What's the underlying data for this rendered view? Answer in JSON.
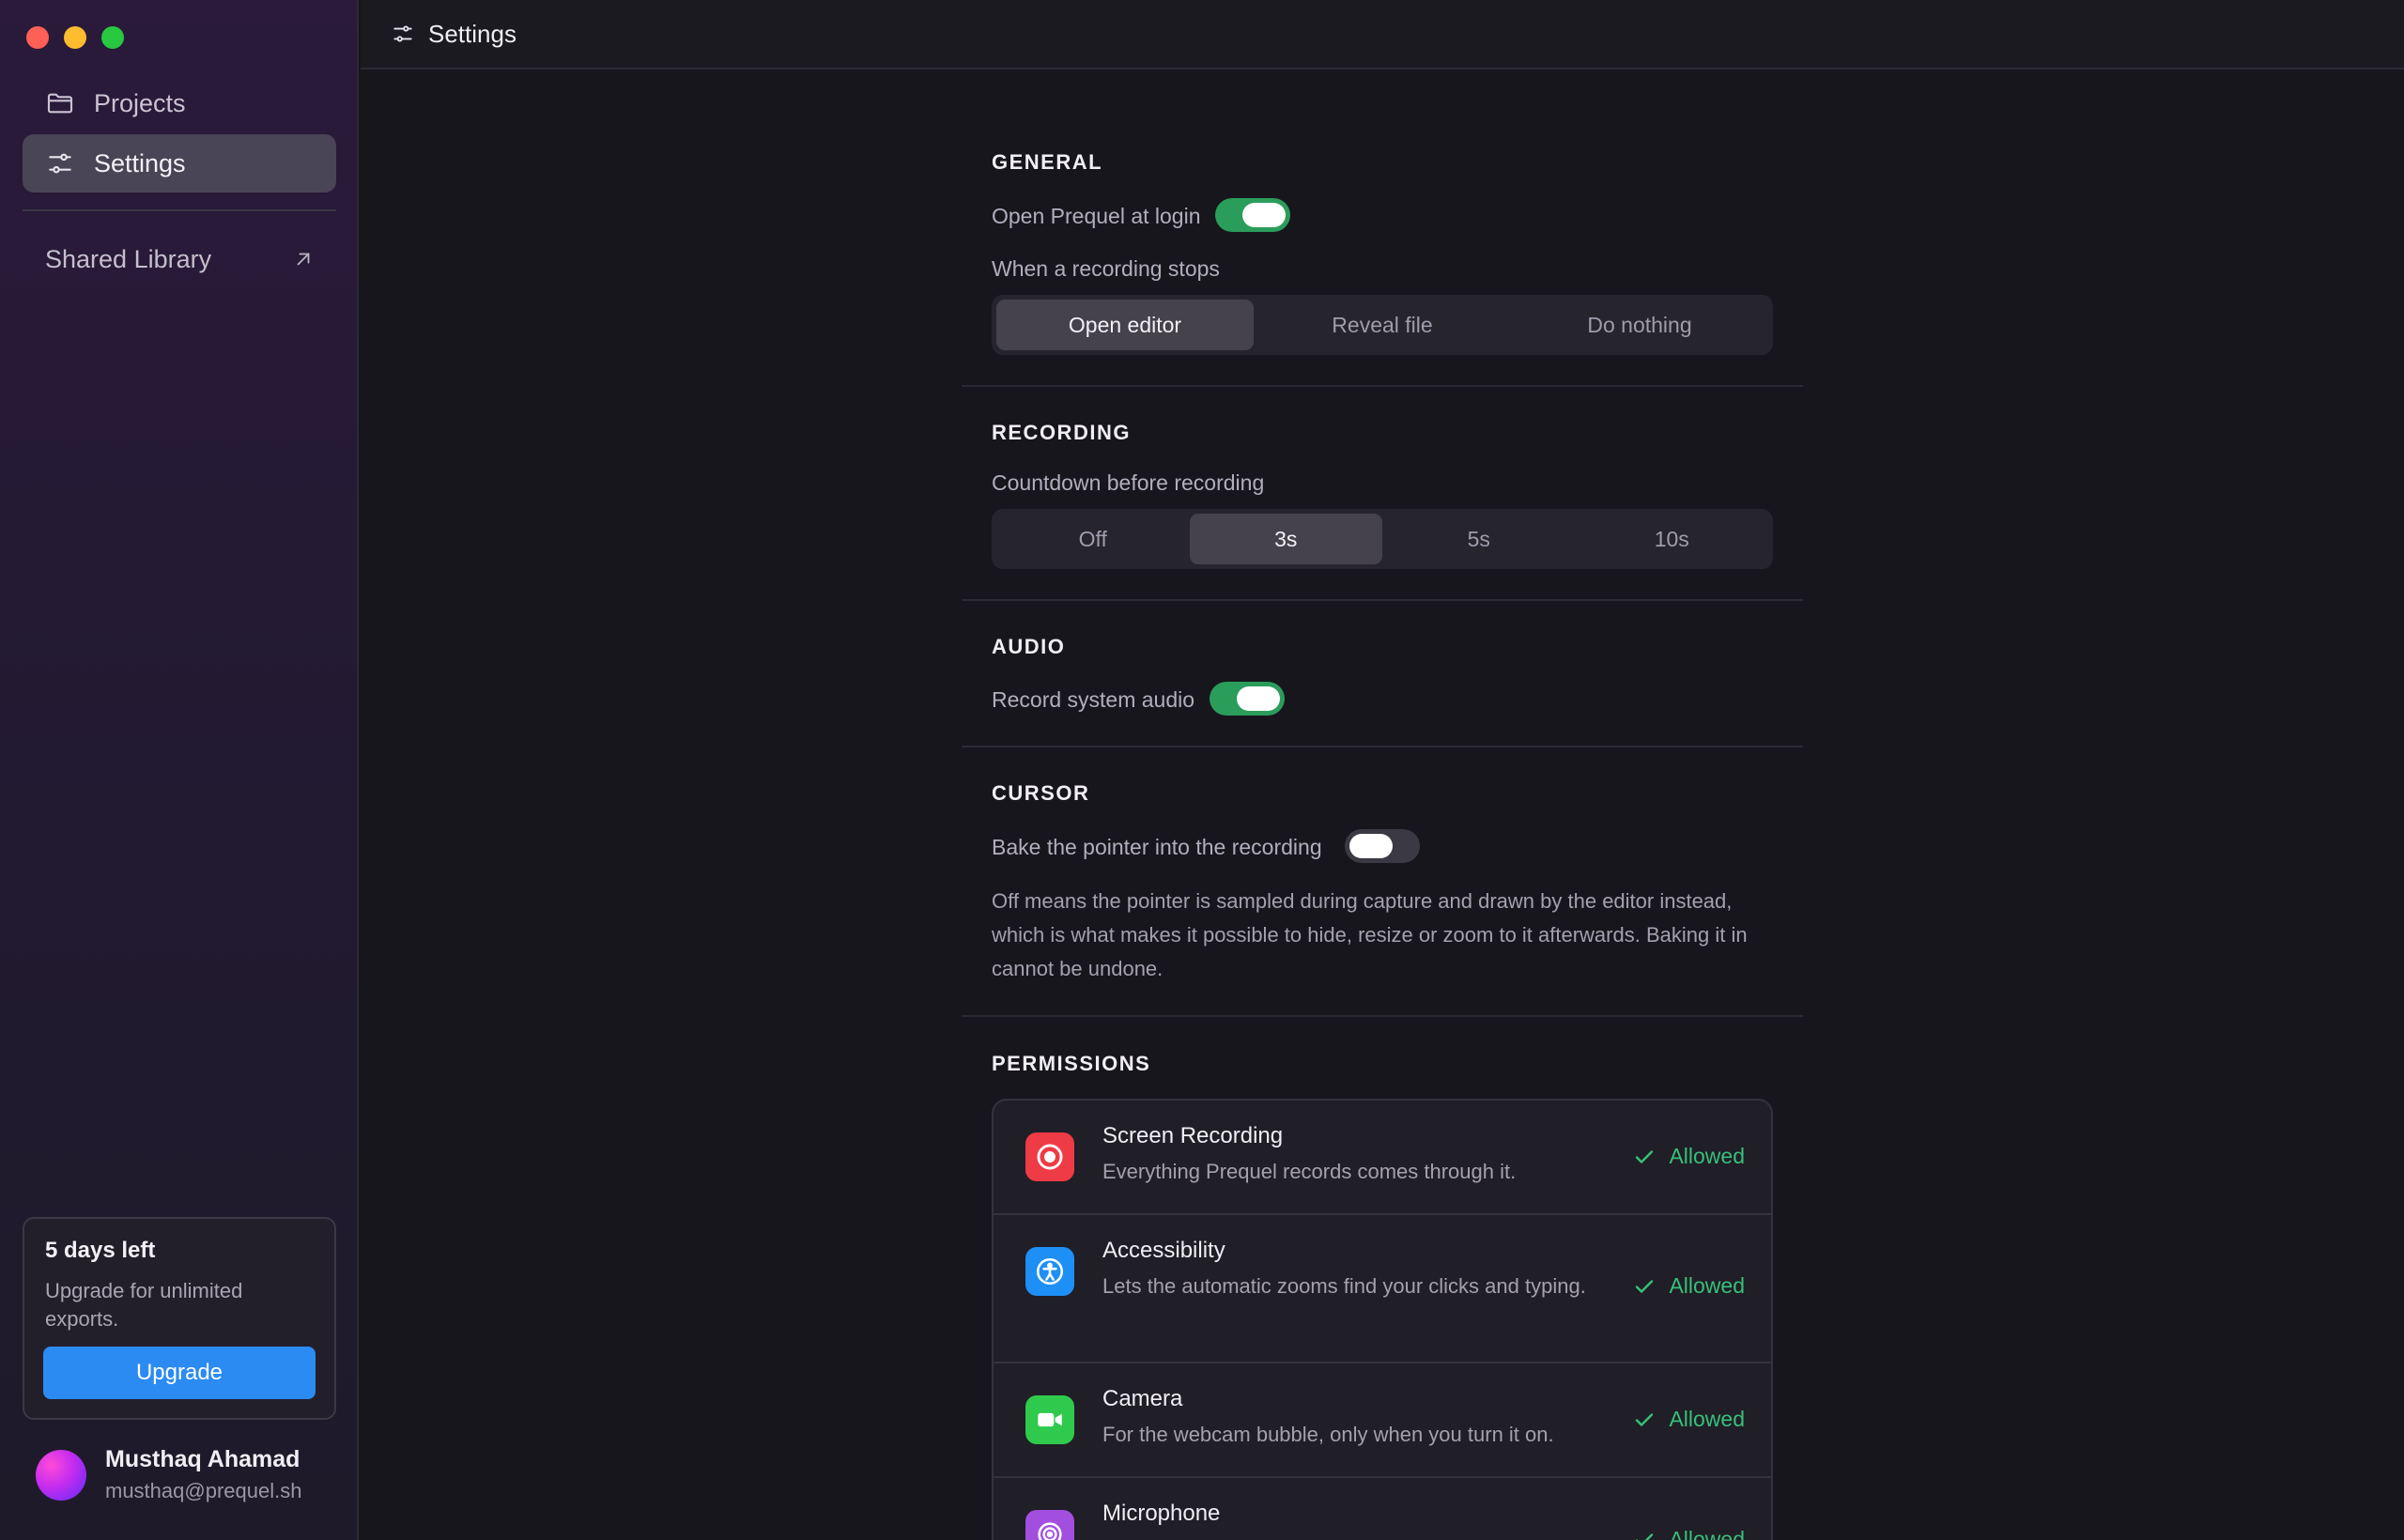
{
  "window": {
    "title": "Settings"
  },
  "sidebar": {
    "nav": [
      {
        "label": "Projects",
        "icon": "folder-icon"
      },
      {
        "label": "Settings",
        "icon": "sliders-icon",
        "active": true
      }
    ],
    "shared_library": {
      "label": "Shared Library",
      "icon": "arrow-up-right-icon"
    },
    "trial": {
      "title": "5 days left",
      "text": "Upgrade for unlimited exports.",
      "button": "Upgrade"
    },
    "user": {
      "name": "Musthaq Ahamad",
      "email": "musthaq@prequel.sh"
    }
  },
  "general": {
    "heading": "GENERAL",
    "open_at_login": {
      "label": "Open Prequel at login",
      "on": true
    },
    "recording_stops": {
      "label": "When a recording stops",
      "options": [
        "Open editor",
        "Reveal file",
        "Do nothing"
      ],
      "selected": "Open editor"
    }
  },
  "recording": {
    "heading": "RECORDING",
    "countdown": {
      "label": "Countdown before recording",
      "options": [
        "Off",
        "3s",
        "5s",
        "10s"
      ],
      "selected": "3s"
    }
  },
  "audio": {
    "heading": "AUDIO",
    "system_audio": {
      "label": "Record system audio",
      "on": true
    }
  },
  "cursor": {
    "heading": "CURSOR",
    "bake_pointer": {
      "label": "Bake the pointer into the recording",
      "on": false
    },
    "help": "Off means the pointer is sampled during capture and drawn by the editor instead, which is what makes it possible to hide, resize or zoom to it afterwards. Baking it in cannot be undone."
  },
  "permissions": {
    "heading": "PERMISSIONS",
    "items": [
      {
        "title": "Screen Recording",
        "desc": "Everything Prequel records comes through it.",
        "status": "Allowed",
        "icon": "record-icon",
        "color": "#ef3b45"
      },
      {
        "title": "Accessibility",
        "desc": "Lets the automatic zooms find your clicks and typing.",
        "status": "Allowed",
        "icon": "accessibility-icon",
        "color": "#1e8ff5"
      },
      {
        "title": "Camera",
        "desc": "For the webcam bubble, only when you turn it on.",
        "status": "Allowed",
        "icon": "camera-icon",
        "color": "#2fca4d"
      },
      {
        "title": "Microphone",
        "desc": "",
        "status": "Allowed",
        "icon": "microphone-icon",
        "color": "#a24fe0"
      }
    ]
  },
  "colors": {
    "accent": "#2b8bf2",
    "toggle_on": "#2a9d5a",
    "allowed": "#37c07a"
  }
}
